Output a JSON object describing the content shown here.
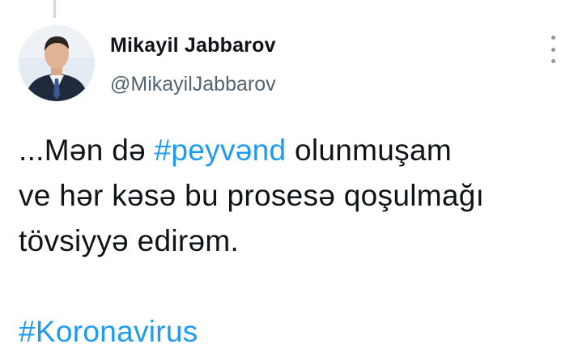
{
  "tweet": {
    "author": {
      "display_name": "Mikayil Jabbarov",
      "handle": "@MikayilJabbarov",
      "avatar_icon": "profile-photo"
    },
    "more_icon": "more-vertical-icon",
    "text": {
      "line1_prefix": "...Mən də ",
      "hashtag1": "#peyvənd",
      "line1_suffix": " olunmuşam",
      "line2": "ve hər kəsə bu prosesə qoşulmağı",
      "line3": "tövsiyyə edirəm.",
      "hashtag2": "#Koronavirus"
    },
    "colors": {
      "link": "#1d9bf0",
      "text": "#0f1419",
      "secondary": "#536471"
    }
  }
}
